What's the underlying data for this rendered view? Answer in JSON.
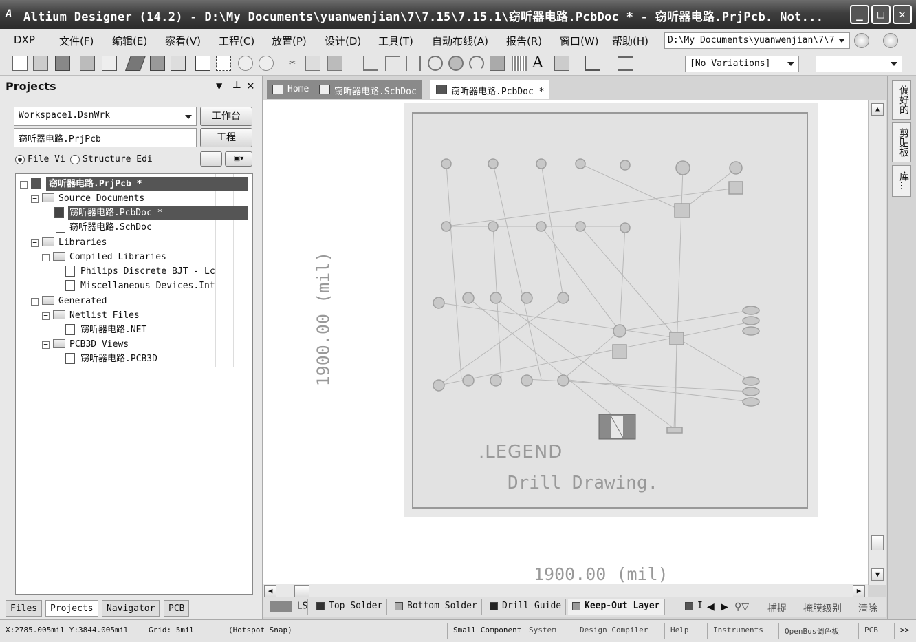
{
  "window": {
    "title": "Altium Designer (14.2) - D:\\My Documents\\yuanwenjian\\7\\7.15\\7.15.1\\窃听器电路.PcbDoc * - 窃听器电路.PrjPcb. Not..."
  },
  "menu": {
    "items": [
      "DXP",
      "文件(F)",
      "编辑(E)",
      "察看(V)",
      "工程(C)",
      "放置(P)",
      "设计(D)",
      "工具(T)",
      "自动布线(A)",
      "报告(R)",
      "窗口(W)",
      "帮助(H)"
    ],
    "path": "D:\\My Documents\\yuanwenjian\\7\\7"
  },
  "toolbar": {
    "variations": "[No Variations]"
  },
  "projects": {
    "header": "Projects",
    "workspace": "Workspace1.DsnWrk",
    "workspace_button": "工作台",
    "project": "窃听器电路.PrjPcb",
    "project_button": "工程",
    "radio_file_view": "File Vi",
    "radio_structure": "Structure Edi",
    "tree": [
      "窃听器电路.PrjPcb *",
      "Source Documents",
      "窃听器电路.PcbDoc *",
      "窃听器电路.SchDoc",
      "Libraries",
      "Compiled Libraries",
      "Philips Discrete BJT - Lc",
      "Miscellaneous Devices.Int",
      "Generated",
      "Netlist Files",
      "窃听器电路.NET",
      "PCB3D Views",
      "窃听器电路.PCB3D"
    ],
    "tabs": [
      "Files",
      "Projects",
      "Navigator",
      "PCB"
    ]
  },
  "doc_tabs": [
    "Home",
    "窃听器电路.SchDoc",
    "窃听器电路.PcbDoc *"
  ],
  "canvas": {
    "legend": ".LEGEND",
    "drill_drawing": "Drill Drawing.",
    "dim_vertical": "1900.00 (mil)",
    "dim_horizontal": "1900.00 (mil)"
  },
  "layers": {
    "ls": "LS",
    "items": [
      "Top Solder",
      "Bottom Solder",
      "Drill Guide",
      "Keep-Out Layer",
      "I"
    ],
    "tools": [
      "捕捉",
      "掩膜级别",
      "清除"
    ]
  },
  "right_dock": [
    "偏好的",
    "剪贴板",
    "库..."
  ],
  "status": {
    "coords": "X:2785.005mil Y:3844.005mil",
    "grid": "Grid: 5mil",
    "snap": "(Hotspot Snap)",
    "component": "Small Component",
    "buttons": [
      "System",
      "Design Compiler",
      "Help",
      "Instruments",
      "OpenBus调色板",
      "PCB"
    ]
  },
  "colors": {
    "title_bar": "#3e3e3e",
    "selection": "#555555",
    "board_bg": "#e2e2e2"
  }
}
